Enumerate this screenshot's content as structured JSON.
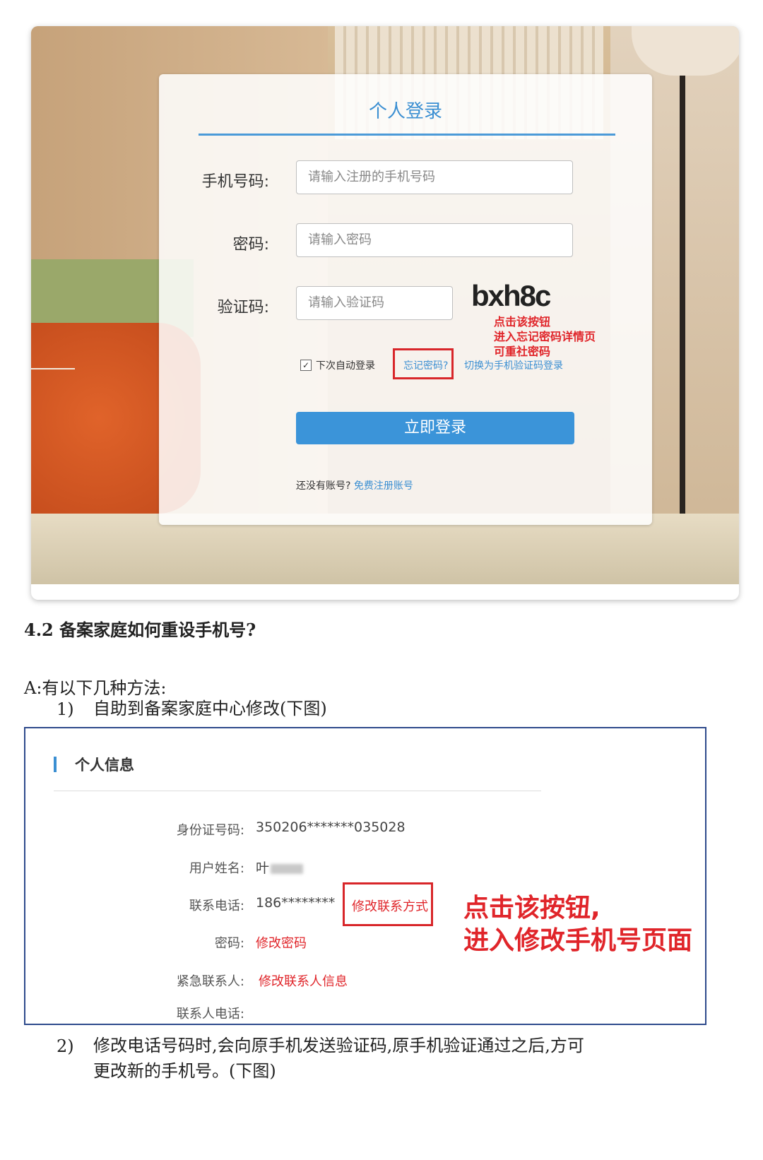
{
  "login": {
    "title": "个人登录",
    "phone_label": "手机号码:",
    "phone_placeholder": "请输入注册的手机号码",
    "password_label": "密码:",
    "password_placeholder": "请输入密码",
    "captcha_label": "验证码:",
    "captcha_placeholder": "请输入验证码",
    "captcha_text": "bxh8c",
    "annotation_lines": [
      "点击该按钮",
      "进入忘记密码详情页",
      "可重社密码"
    ],
    "remember_checked": "✓",
    "remember_label": "下次自动登录",
    "forgot_link": "忘记密码?",
    "switch_link": "切换为手机验证码登录",
    "login_button": "立即登录",
    "no_account": "还没有账号?",
    "signup_link": "免费注册账号"
  },
  "doc": {
    "section_heading": "4.2 备案家庭如何重设手机号?",
    "answer_intro": "A:有以下几种方法:",
    "item1_num": "1)",
    "item1_text": "自助到备案家庭中心修改(下图)",
    "item2_num": "2)",
    "item2_line1": "修改电话号码时,会向原手机发送验证码,原手机验证通过之后,方可",
    "item2_line2": "更改新的手机号。(下图)"
  },
  "info": {
    "title": "个人信息",
    "id_label": "身份证号码:",
    "id_value": "350206*******035028",
    "name_label": "用户姓名:",
    "name_value": "叶",
    "phone_label": "联系电话:",
    "phone_value": "186********",
    "modify_contact": "修改联系方式",
    "password_label": "密码:",
    "modify_password": "修改密码",
    "emergency_label": "紧急联系人:",
    "modify_emergency": "修改联系人信息",
    "contact_phone_label": "联系人电话:",
    "annotation_lines": [
      "点击该按钮,",
      "进入修改手机号页面"
    ]
  }
}
